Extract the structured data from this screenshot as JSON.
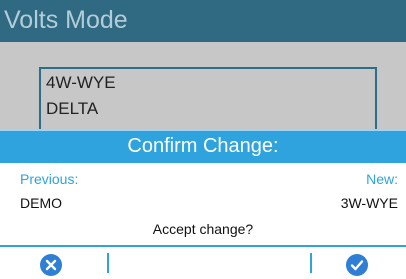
{
  "background": {
    "title": "Volts Mode",
    "list_items": [
      "4W-WYE",
      "DELTA"
    ]
  },
  "dialog": {
    "title": "Confirm Change:",
    "previous_label": "Previous:",
    "new_label": "New:",
    "previous_value": "DEMO",
    "new_value": "3W-WYE",
    "question": "Accept change?",
    "cancel_icon": "x-circle-icon",
    "confirm_icon": "check-circle-icon"
  },
  "colors": {
    "header_bg": "#2f6a82",
    "dialog_accent": "#2fa3de",
    "button_blue": "#2f7fd6",
    "dim_bg": "#c7c7c7"
  }
}
